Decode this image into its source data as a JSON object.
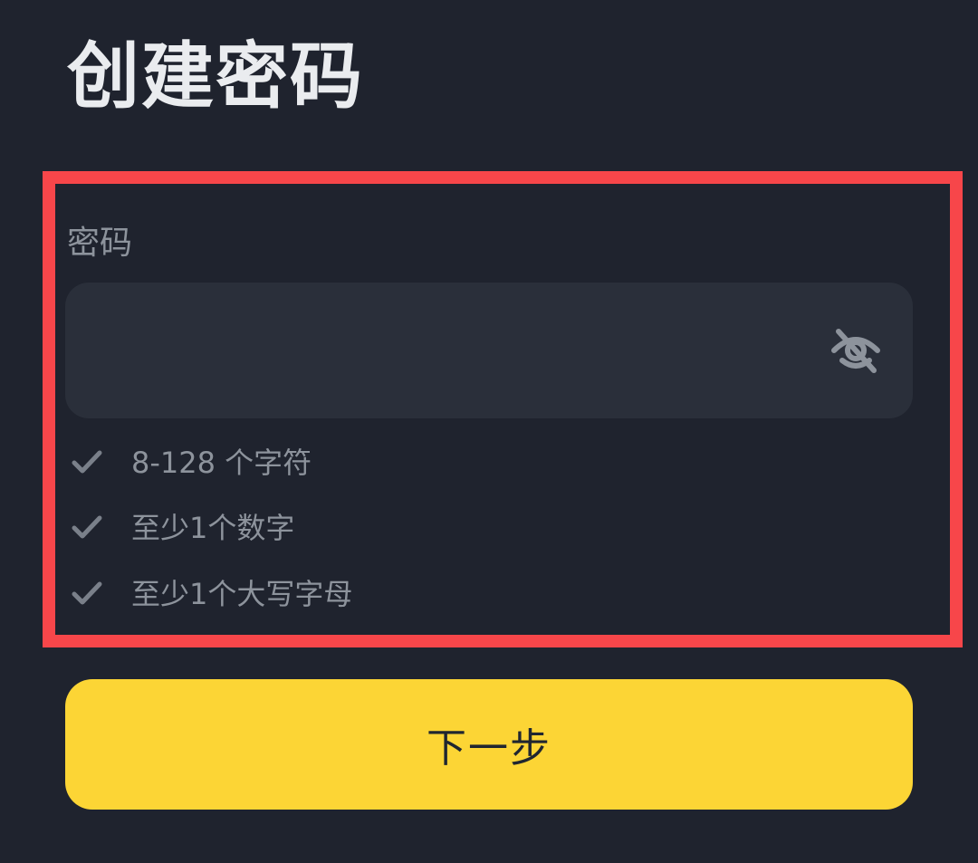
{
  "header": {
    "title": "创建密码"
  },
  "password_field": {
    "label": "密码",
    "value": "",
    "placeholder": "",
    "visibility_icon": "eye-slash-icon"
  },
  "requirements": [
    {
      "text": "8-128 个字符",
      "icon": "check-icon",
      "met": false
    },
    {
      "text": "至少1个数字",
      "icon": "check-icon",
      "met": false
    },
    {
      "text": "至少1个大写字母",
      "icon": "check-icon",
      "met": false
    }
  ],
  "actions": {
    "next_label": "下一步"
  },
  "colors": {
    "background": "#1f232e",
    "input_background": "#2a2f3a",
    "accent": "#fcd535",
    "highlight_border": "#f7464a",
    "muted_text": "#8d939c",
    "title_text": "#eaecef"
  }
}
